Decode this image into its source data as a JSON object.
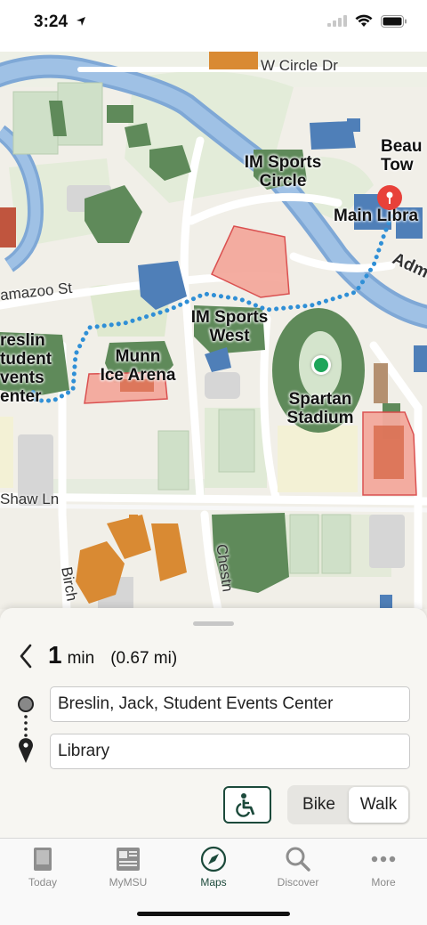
{
  "status": {
    "time": "3:24"
  },
  "map": {
    "labels": {
      "im_sports_circle": "IM Sports\nCircle",
      "main_library": "Main Libra",
      "beau_tower": "Beau\nTow",
      "im_sports_west": "IM Sports\nWest",
      "munn_ice_arena": "Munn\nIce Arena",
      "breslin": "reslin\ntudent\nvents\nenter",
      "spartan_stadium": "Spartan\nStadium"
    },
    "streets": {
      "w_circle_dr": "W Circle Dr",
      "kalamazoo_st": "amazoo St",
      "adm": "Adm",
      "shaw_ln": "Shaw Ln",
      "birch": "Birch",
      "chestnut": "Chestn"
    },
    "colors": {
      "route": "#2f8fd6",
      "origin": "#1ea55a",
      "destination": "#e8413a",
      "building": "#5f8a5a"
    }
  },
  "sheet": {
    "eta_value": "1",
    "eta_unit": "min",
    "distance": "(0.67 mi)",
    "from": "Breslin, Jack, Student Events Center",
    "to": "Library",
    "modes": [
      "Bike",
      "Walk"
    ],
    "selected_mode": "Walk"
  },
  "tabs": [
    {
      "label": "Today",
      "icon": "book-icon"
    },
    {
      "label": "MyMSU",
      "icon": "news-icon"
    },
    {
      "label": "Maps",
      "icon": "compass-icon",
      "active": true
    },
    {
      "label": "Discover",
      "icon": "search-icon"
    },
    {
      "label": "More",
      "icon": "more-icon"
    }
  ]
}
